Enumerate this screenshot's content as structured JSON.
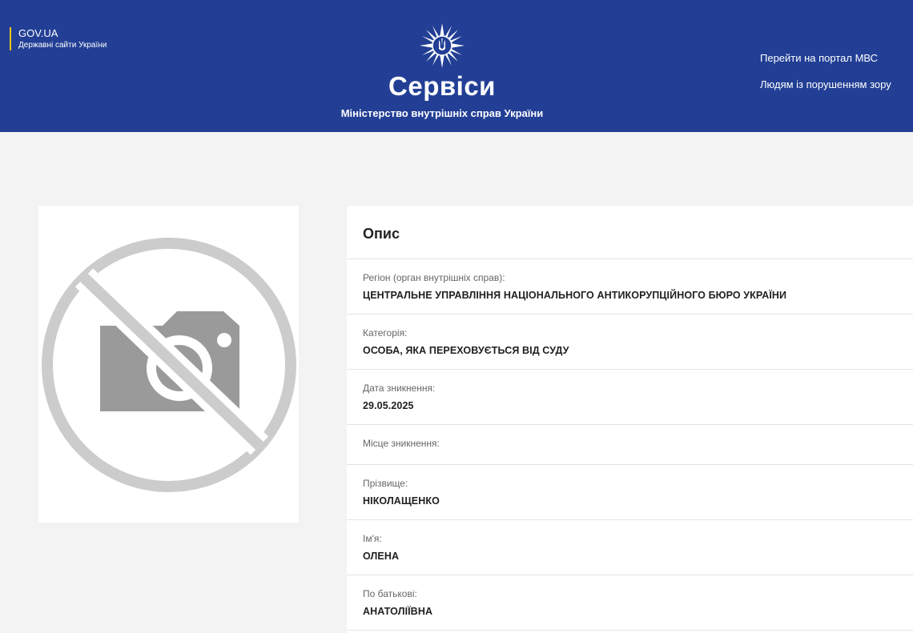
{
  "header": {
    "gov_title": "GOV.UA",
    "gov_subtitle": "Державні сайти України",
    "title": "Сервіси",
    "subtitle": "Міністерство внутрішніх справ України",
    "links": [
      "Перейти на портал МВС",
      "Людям із порушенням зору"
    ],
    "background_color": "#223f95",
    "accent_color": "#f5c518"
  },
  "photo": {
    "icon": "no-photo-icon"
  },
  "details": {
    "title": "Опис",
    "fields": [
      {
        "label": "Регіон (орган внутрішніх справ):",
        "value": "ЦЕНТРАЛЬНЕ УПРАВЛІННЯ НАЦІОНАЛЬНОГО АНТИКОРУПЦІЙНОГО БЮРО УКРАЇНИ"
      },
      {
        "label": "Категорія:",
        "value": "ОСОБА, ЯКА ПЕРЕХОВУЄТЬСЯ ВІД СУДУ"
      },
      {
        "label": "Дата зникнення:",
        "value": "29.05.2025"
      },
      {
        "label": "Місце зникнення:",
        "value": ""
      },
      {
        "label": "Прізвище:",
        "value": "НІКОЛАЩЕНКО"
      },
      {
        "label": "Ім'я:",
        "value": "ОЛЕНА"
      },
      {
        "label": "По батькові:",
        "value": "АНАТОЛІЇВНА"
      }
    ]
  }
}
